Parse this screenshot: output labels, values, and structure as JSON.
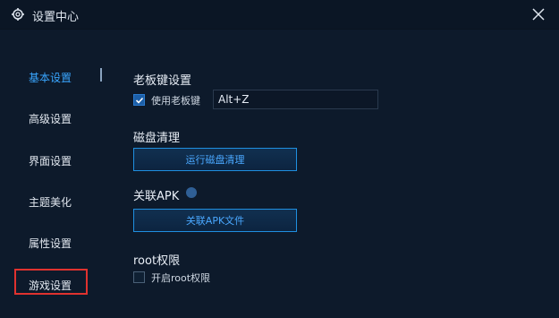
{
  "window": {
    "title": "设置中心",
    "icons": {
      "title": "gear-icon",
      "close": "close-icon"
    }
  },
  "sidebar": {
    "items": [
      {
        "label": "基本设置",
        "active": true
      },
      {
        "label": "高级设置"
      },
      {
        "label": "界面设置"
      },
      {
        "label": "主题美化"
      },
      {
        "label": "属性设置"
      },
      {
        "label": "游戏设置"
      }
    ]
  },
  "boss_key": {
    "title": "老板键设置",
    "checkbox_label": "使用老板键",
    "checked": true,
    "hotkey_value": "Alt+Z"
  },
  "disk": {
    "title": "磁盘清理",
    "button_label": "运行磁盘清理"
  },
  "apk": {
    "title": "关联APK",
    "button_label": "关联APK文件",
    "icon": "help-icon"
  },
  "root": {
    "title": "root权限",
    "checkbox_label": "开启root权限",
    "checked": false
  },
  "colors": {
    "background": "#0d1a2b",
    "accent": "#39a6ff",
    "button_border": "#1f8fe0",
    "highlight": "#e0322f"
  }
}
